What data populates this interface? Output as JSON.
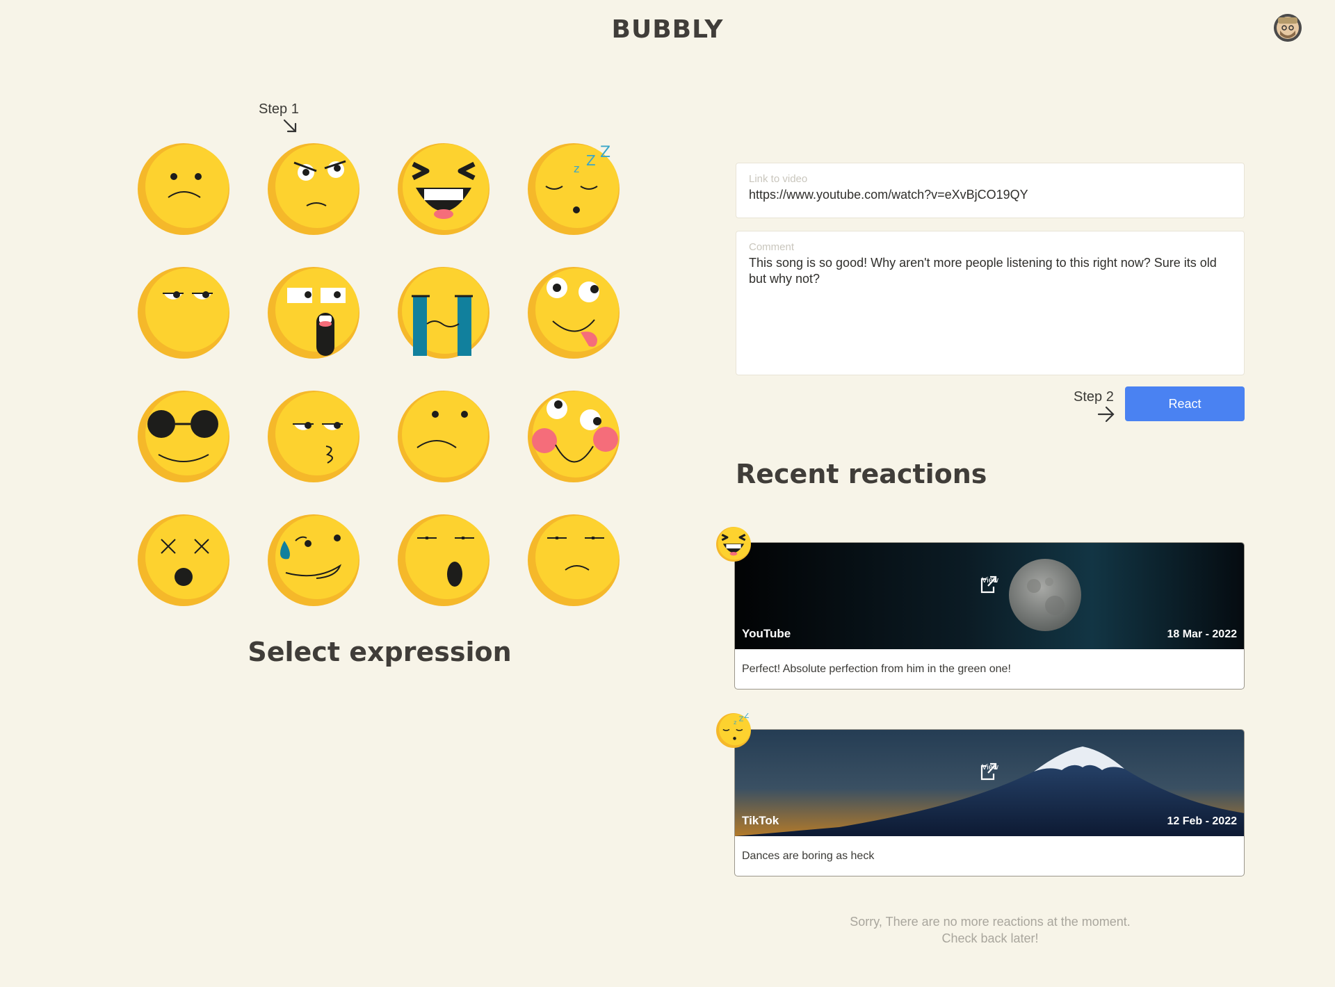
{
  "app": {
    "title": "BUBBLY"
  },
  "header": {
    "avatar_icon": "user-avatar"
  },
  "steps": {
    "step1": "Step 1",
    "step2": "Step 2"
  },
  "emoji_grid": {
    "title": "Select expression",
    "items": [
      "sad-face",
      "angry-face",
      "laughing-face",
      "sleeping-face",
      "unamused-face",
      "shocked-face",
      "crying-face",
      "silly-tongue-face",
      "sunglasses-face",
      "smirking-face",
      "worried-face",
      "blushing-face",
      "dizzy-face",
      "sweat-smile-face",
      "yawning-face",
      "sleepy-face"
    ]
  },
  "form": {
    "link_label": "Link to video",
    "link_value": "https://www.youtube.com/watch?v=eXvBjCO19QY",
    "comment_label": "Comment",
    "comment_value": "This song is so good! Why aren't more people listening to this right now? Sure its old but why not?",
    "react_button": "React"
  },
  "recent": {
    "title": "Recent reactions",
    "items": [
      {
        "emoji": "laughing-face",
        "platform": "YouTube",
        "date": "18 Mar - 2022",
        "view_label": "View",
        "comment": "Perfect! Absolute perfection from him in the green one!"
      },
      {
        "emoji": "sleeping-face",
        "platform": "TikTok",
        "date": "12 Feb - 2022",
        "view_label": "View",
        "comment": "Dances are boring as heck"
      }
    ],
    "empty_line1": "Sorry, There are no more reactions at the moment.",
    "empty_line2": "Check back later!"
  },
  "colors": {
    "background": "#f7f4e8",
    "accent": "#4a82f2",
    "emoji_yellow": "#fdd22f",
    "emoji_shadow": "#f5b82a"
  }
}
